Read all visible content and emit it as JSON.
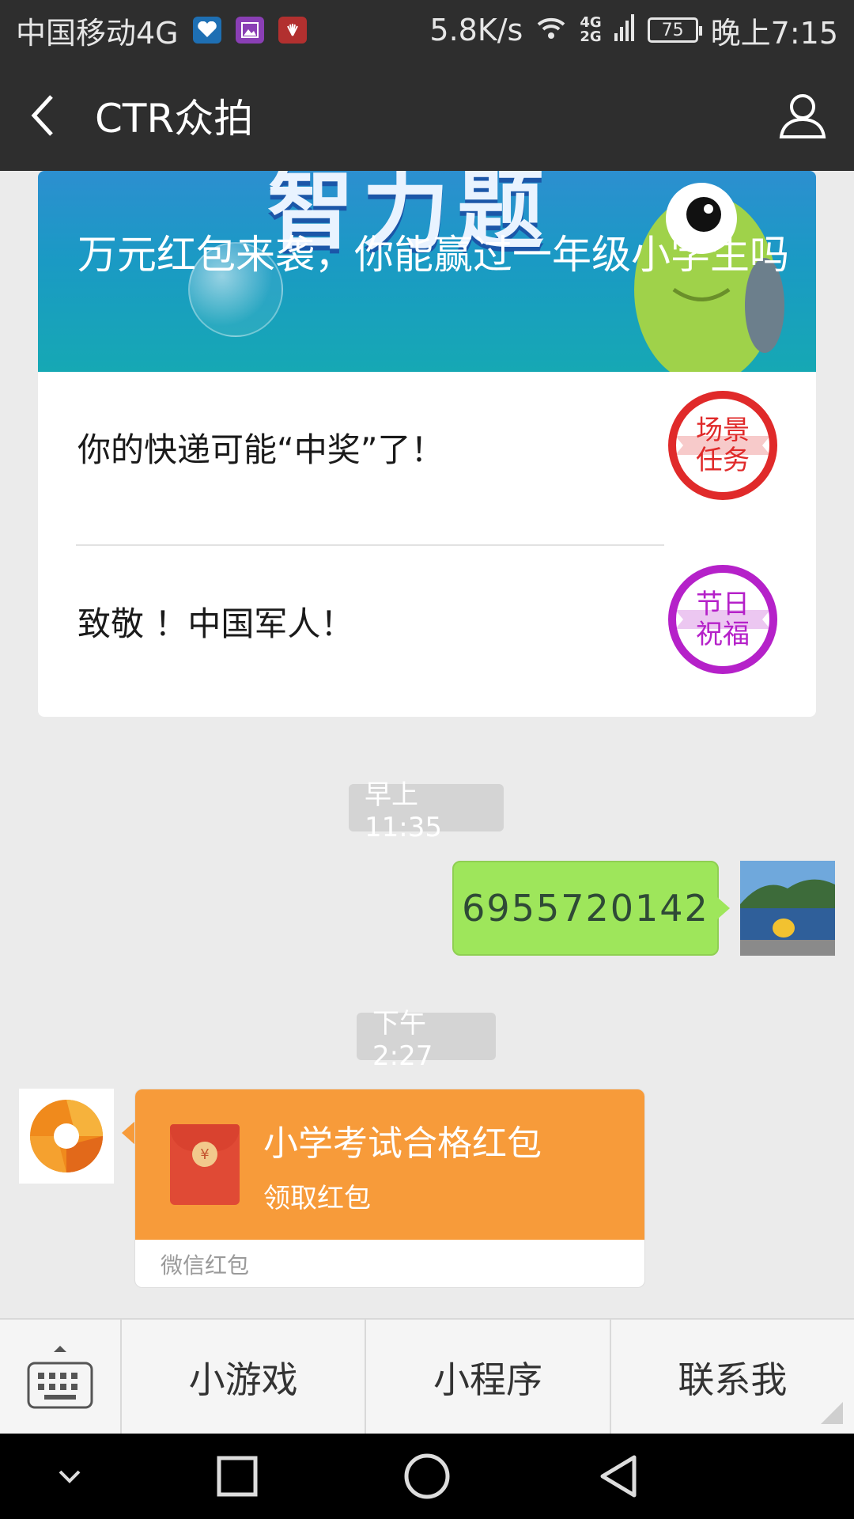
{
  "status_bar": {
    "carrier": "中国移动4G",
    "speed": "5.8K/s",
    "network_top": "4G",
    "network_bottom": "2G",
    "battery": "75",
    "time": "晚上7:15"
  },
  "header": {
    "title": "CTR众拍",
    "back_icon": "chevron-left-icon",
    "profile_icon": "person-icon"
  },
  "article_card": {
    "hero_title": "万元红包来袭，你能赢过一年级小学生吗",
    "hero_logo_text": "智力题",
    "items": [
      {
        "title": "你的快递可能“中奖”了！",
        "badge_line1": "场景",
        "badge_line2": "任务",
        "badge_color": "#e02a2a"
      },
      {
        "title": "致敬 ！中国军人！",
        "badge_line1": "节日",
        "badge_line2": "祝福",
        "badge_color": "#b521c9"
      }
    ]
  },
  "messages": {
    "time_1": "早上11:35",
    "sent_text": "6955720142",
    "time_2": "下午2:27",
    "red_packet": {
      "title": "小学考试合格红包",
      "subtitle": "领取红包",
      "footer": "微信红包",
      "coin_symbol": "¥",
      "color": "#f79b3a"
    }
  },
  "menu": {
    "items": [
      "小游戏",
      "小程序",
      "联系我"
    ]
  },
  "nav": {
    "icons": [
      "chevron-down-icon",
      "recent-apps-icon",
      "home-icon",
      "back-icon"
    ]
  },
  "colors": {
    "header_bg": "#2e2e2e",
    "chat_bg": "#ebebeb",
    "sent_bubble": "#9ee65b"
  }
}
